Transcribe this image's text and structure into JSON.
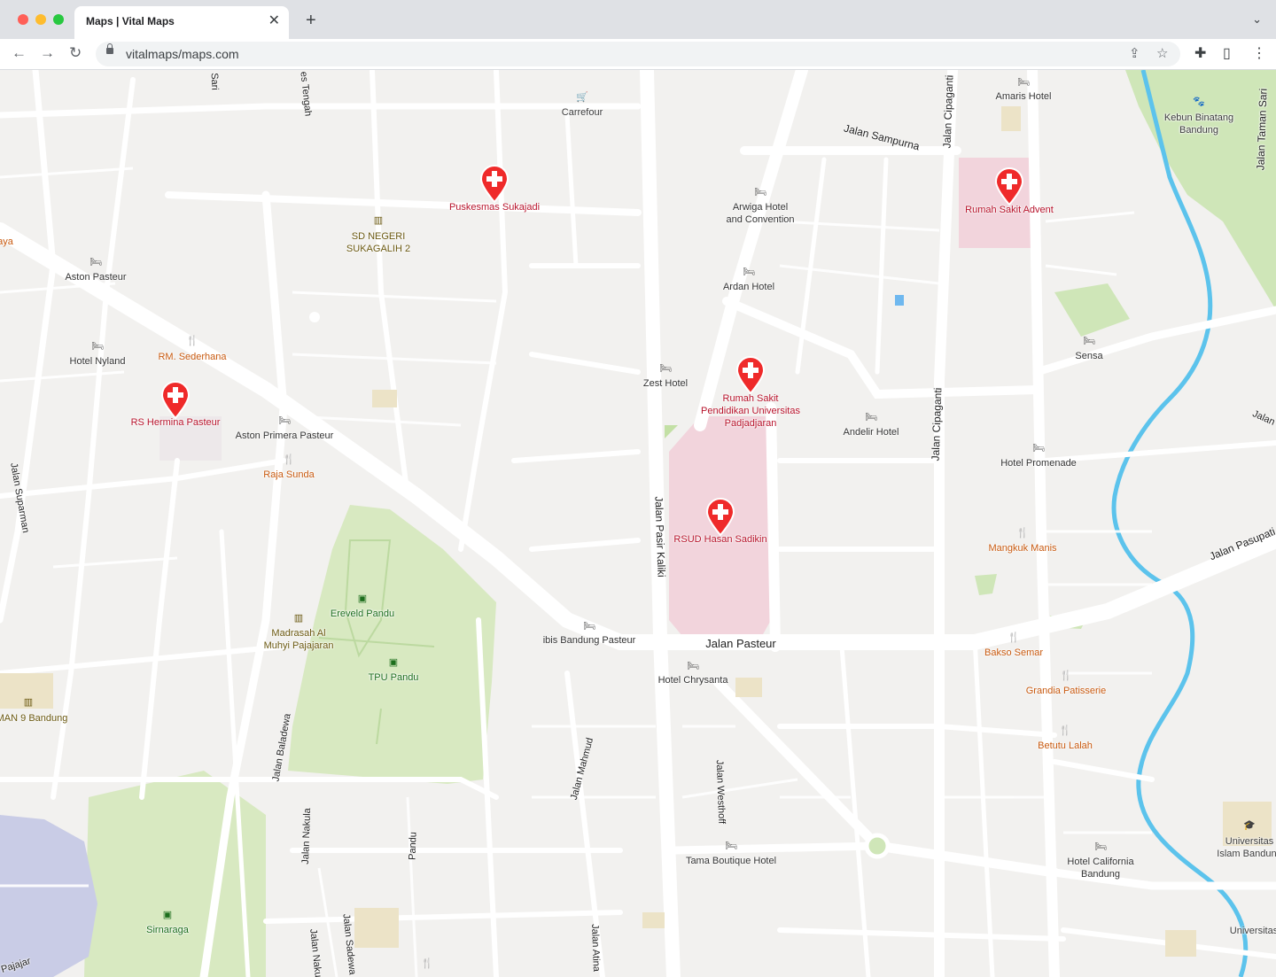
{
  "browser": {
    "tab_title": "Maps | Vital Maps",
    "close_glyph": "✕",
    "newtab_glyph": "+",
    "tabmenu_glyph": "⌄",
    "url": "vitalmaps/maps.com",
    "back_glyph": "←",
    "forward_glyph": "→",
    "reload_glyph": "↻",
    "share_glyph": "⇪",
    "star_glyph": "☆",
    "extension_glyph": "✚",
    "sidepanel_glyph": "▯",
    "menu_glyph": "⋮",
    "dot_colors": [
      "#ff5f57",
      "#febc2e",
      "#28c840"
    ]
  },
  "map": {
    "colors": {
      "background": "#f2f1ef",
      "road": "#ffffff",
      "park": "#cfe6b8",
      "hospital_area": "#f2d4dc",
      "river": "#5cc3ec",
      "hospital_pin": "#ef2a2a"
    },
    "hospitals": [
      {
        "name": "Puskesmas Sukajadi"
      },
      {
        "name": "Rumah Sakit Advent"
      },
      {
        "name": "RS Hermina Pasteur"
      },
      {
        "name": "Rumah Sakit Pendidikan Universitas Padjadjaran",
        "line1": "Rumah Sakit",
        "line2": "Pendidikan Universitas",
        "line3": "Padjadjaran"
      },
      {
        "name": "RSUD Hasan Sadikin"
      }
    ],
    "hotels": {
      "amaris": "Amaris Hotel",
      "arwiga_1": "Arwiga Hotel",
      "arwiga_2": "and Convention",
      "aston": "Aston Pasteur",
      "ardan": "Ardan Hotel",
      "nyland": "Hotel Nyland",
      "zest": "Zest Hotel",
      "sensa": "Sensa",
      "aston_primera": "Aston Primera Pasteur",
      "andelir": "Andelir Hotel",
      "promenade": "Hotel Promenade",
      "ibis": "ibis Bandung Pasteur",
      "chrysanta": "Hotel Chrysanta",
      "tama": "Tama Boutique Hotel",
      "california_1": "Hotel California",
      "california_2": "Bandung"
    },
    "food": {
      "sederhana": "RM. Sederhana",
      "raja_sunda": "Raja Sunda",
      "mangkuk": "Mangkuk Manis",
      "bakso": "Bakso Semar",
      "grandia": "Grandia Patisserie",
      "betutu": "Betutu Lalah"
    },
    "places": {
      "carrefour": "Carrefour",
      "sd_1": "SD NEGERI",
      "sd_2": "SUKAGALIH 2",
      "kebun_1": "Kebun Binatang",
      "kebun_2": "Bandung",
      "ereveld": "Ereveld Pandu",
      "madrasah_1": "Madrasah Al",
      "madrasah_2": "Muhyi Pajajaran",
      "tpu": "TPU Pandu",
      "man9": "MAN 9 Bandung",
      "sirnaraga": "Sirnaraga",
      "univ_1": "Universitas",
      "univ_2": "Islam Bandung",
      "univ_edge": "Universitas",
      "aya": "aya"
    },
    "streets": {
      "sampurna": "Jalan Sampurna",
      "cipaganti_top": "Jalan Cipaganti",
      "cipaganti": "Jalan Cipaganti",
      "taman_sari": "Jalan Taman Sari",
      "pasir_kaliki": "Jalan Pasir Kaliki",
      "pasteur": "Jalan Pasteur",
      "pasupati": "Jalan Pasupati",
      "suparman": "Jalan Suparman",
      "baladewa": "Jalan Baladewa",
      "nakula": "Jalan Nakula",
      "mahmud": "Jalan Mahmud",
      "westhoff": "Jalan Westhoff",
      "pandu": "Pandu",
      "atina": "Jalan Atina",
      "sadewa": "Jalan Sadewa",
      "naku2": "Jalan Naku",
      "tengah": "es Tengah",
      "sari": "Sari",
      "jalan_edge": "Jalan",
      "pajajaran": "Pajajar"
    }
  }
}
